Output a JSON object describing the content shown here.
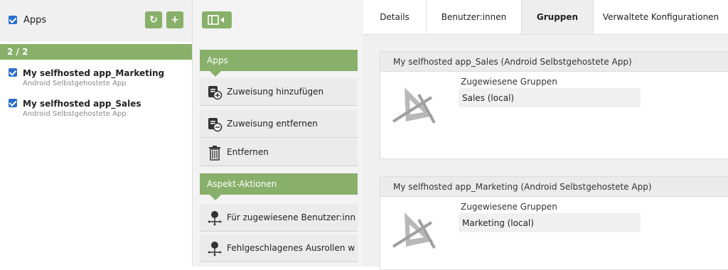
{
  "left": {
    "title": "Apps",
    "refresh_icon": "refresh-icon",
    "add_icon": "plus-icon",
    "count": "2 / 2",
    "apps": [
      {
        "name": "My selfhosted app_Marketing",
        "subtitle": "Android Selbstgehostete App",
        "checked": true
      },
      {
        "name": "My selfhosted app_Sales",
        "subtitle": "Android Selbstgehostete App",
        "checked": true
      }
    ]
  },
  "middle": {
    "toggle_icon": "panel-toggle-icon",
    "sections": [
      {
        "title": "Apps",
        "actions": [
          {
            "label": "Zuweisung hinzufügen",
            "icon": "add-assignment-icon"
          },
          {
            "label": "Zuweisung entfernen",
            "icon": "remove-assignment-icon"
          },
          {
            "label": "Entfernen",
            "icon": "trash-icon"
          }
        ]
      },
      {
        "title": "Aspekt-Aktionen",
        "actions": [
          {
            "label": "Für zugewiesene Benutzer:inn...",
            "icon": "user-network-icon"
          },
          {
            "label": "Fehlgeschlagenes Ausrollen w...",
            "icon": "user-network-icon"
          }
        ]
      }
    ]
  },
  "right": {
    "tabs": [
      {
        "label": "Details",
        "active": false
      },
      {
        "label": "Benutzer:innen",
        "active": false
      },
      {
        "label": "Gruppen",
        "active": true
      },
      {
        "label": "Verwaltete Konfigurationen",
        "active": false
      }
    ],
    "cards": [
      {
        "title": "My selfhosted app_Sales (Android Selbstgehostete App)",
        "group_label": "Zugewiesene Gruppen",
        "group_value": "Sales (local)"
      },
      {
        "title": "My selfhosted app_Marketing (Android Selbstgehostete App)",
        "group_label": "Zugewiesene Gruppen",
        "group_value": "Marketing (local)"
      }
    ]
  },
  "colors": {
    "accent": "#88b06a",
    "checkbox": "#2a6ecf"
  }
}
